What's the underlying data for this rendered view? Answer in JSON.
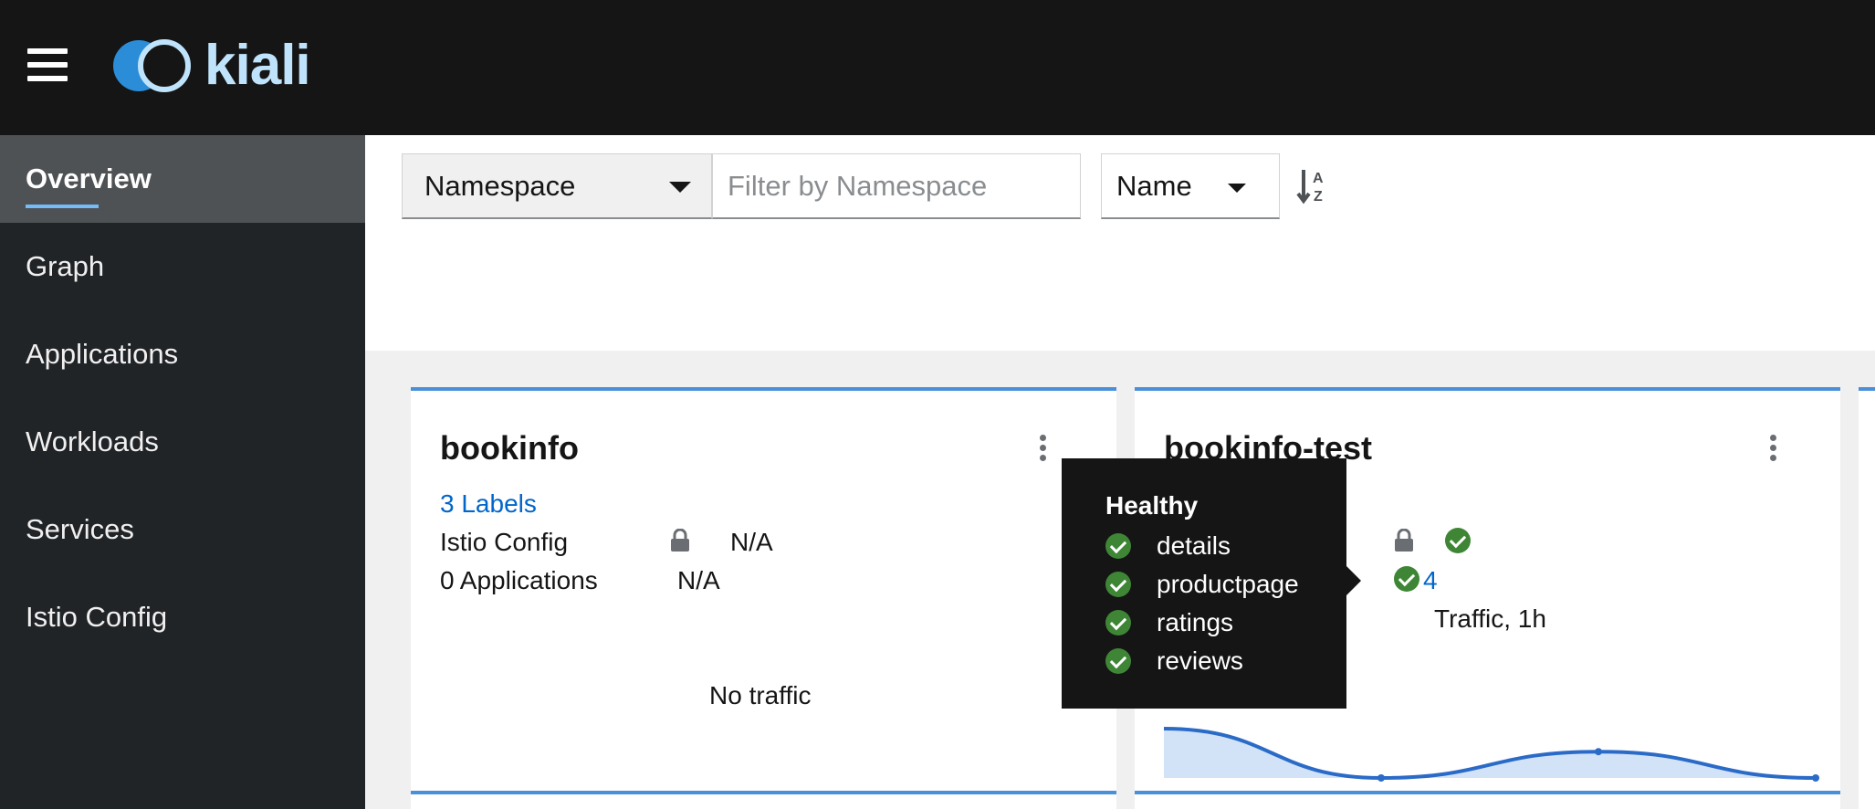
{
  "app": {
    "logo_text": "kiali"
  },
  "sidebar": {
    "items": [
      {
        "label": "Overview"
      },
      {
        "label": "Graph"
      },
      {
        "label": "Applications"
      },
      {
        "label": "Workloads"
      },
      {
        "label": "Services"
      },
      {
        "label": "Istio Config"
      }
    ]
  },
  "toolbar": {
    "filter_type": "Namespace",
    "filter_placeholder": "Filter by Namespace",
    "sort_field": "Name"
  },
  "cards": [
    {
      "title": "bookinfo",
      "labels_link": "3 Labels",
      "istio_config_label": "Istio Config",
      "istio_config_value": "N/A",
      "applications_label": "0 Applications",
      "applications_value": "N/A",
      "traffic_text": "No traffic"
    },
    {
      "title": "bookinfo-test",
      "app_count": "4",
      "traffic_label": "Traffic, 1h",
      "sparkline": [
        0.6,
        0.0,
        0.32,
        0.0
      ]
    }
  ],
  "tooltip": {
    "title": "Healthy",
    "items": [
      "details",
      "productpage",
      "ratings",
      "reviews"
    ]
  },
  "colors": {
    "masthead": "#151515",
    "sidebar": "#212427",
    "accent": "#73bcf7",
    "card_border": "#4a90d9",
    "healthy": "#3e8635",
    "link": "#0066cc",
    "chart_line": "#2b6bc8",
    "chart_fill": "#d3e3f7"
  }
}
